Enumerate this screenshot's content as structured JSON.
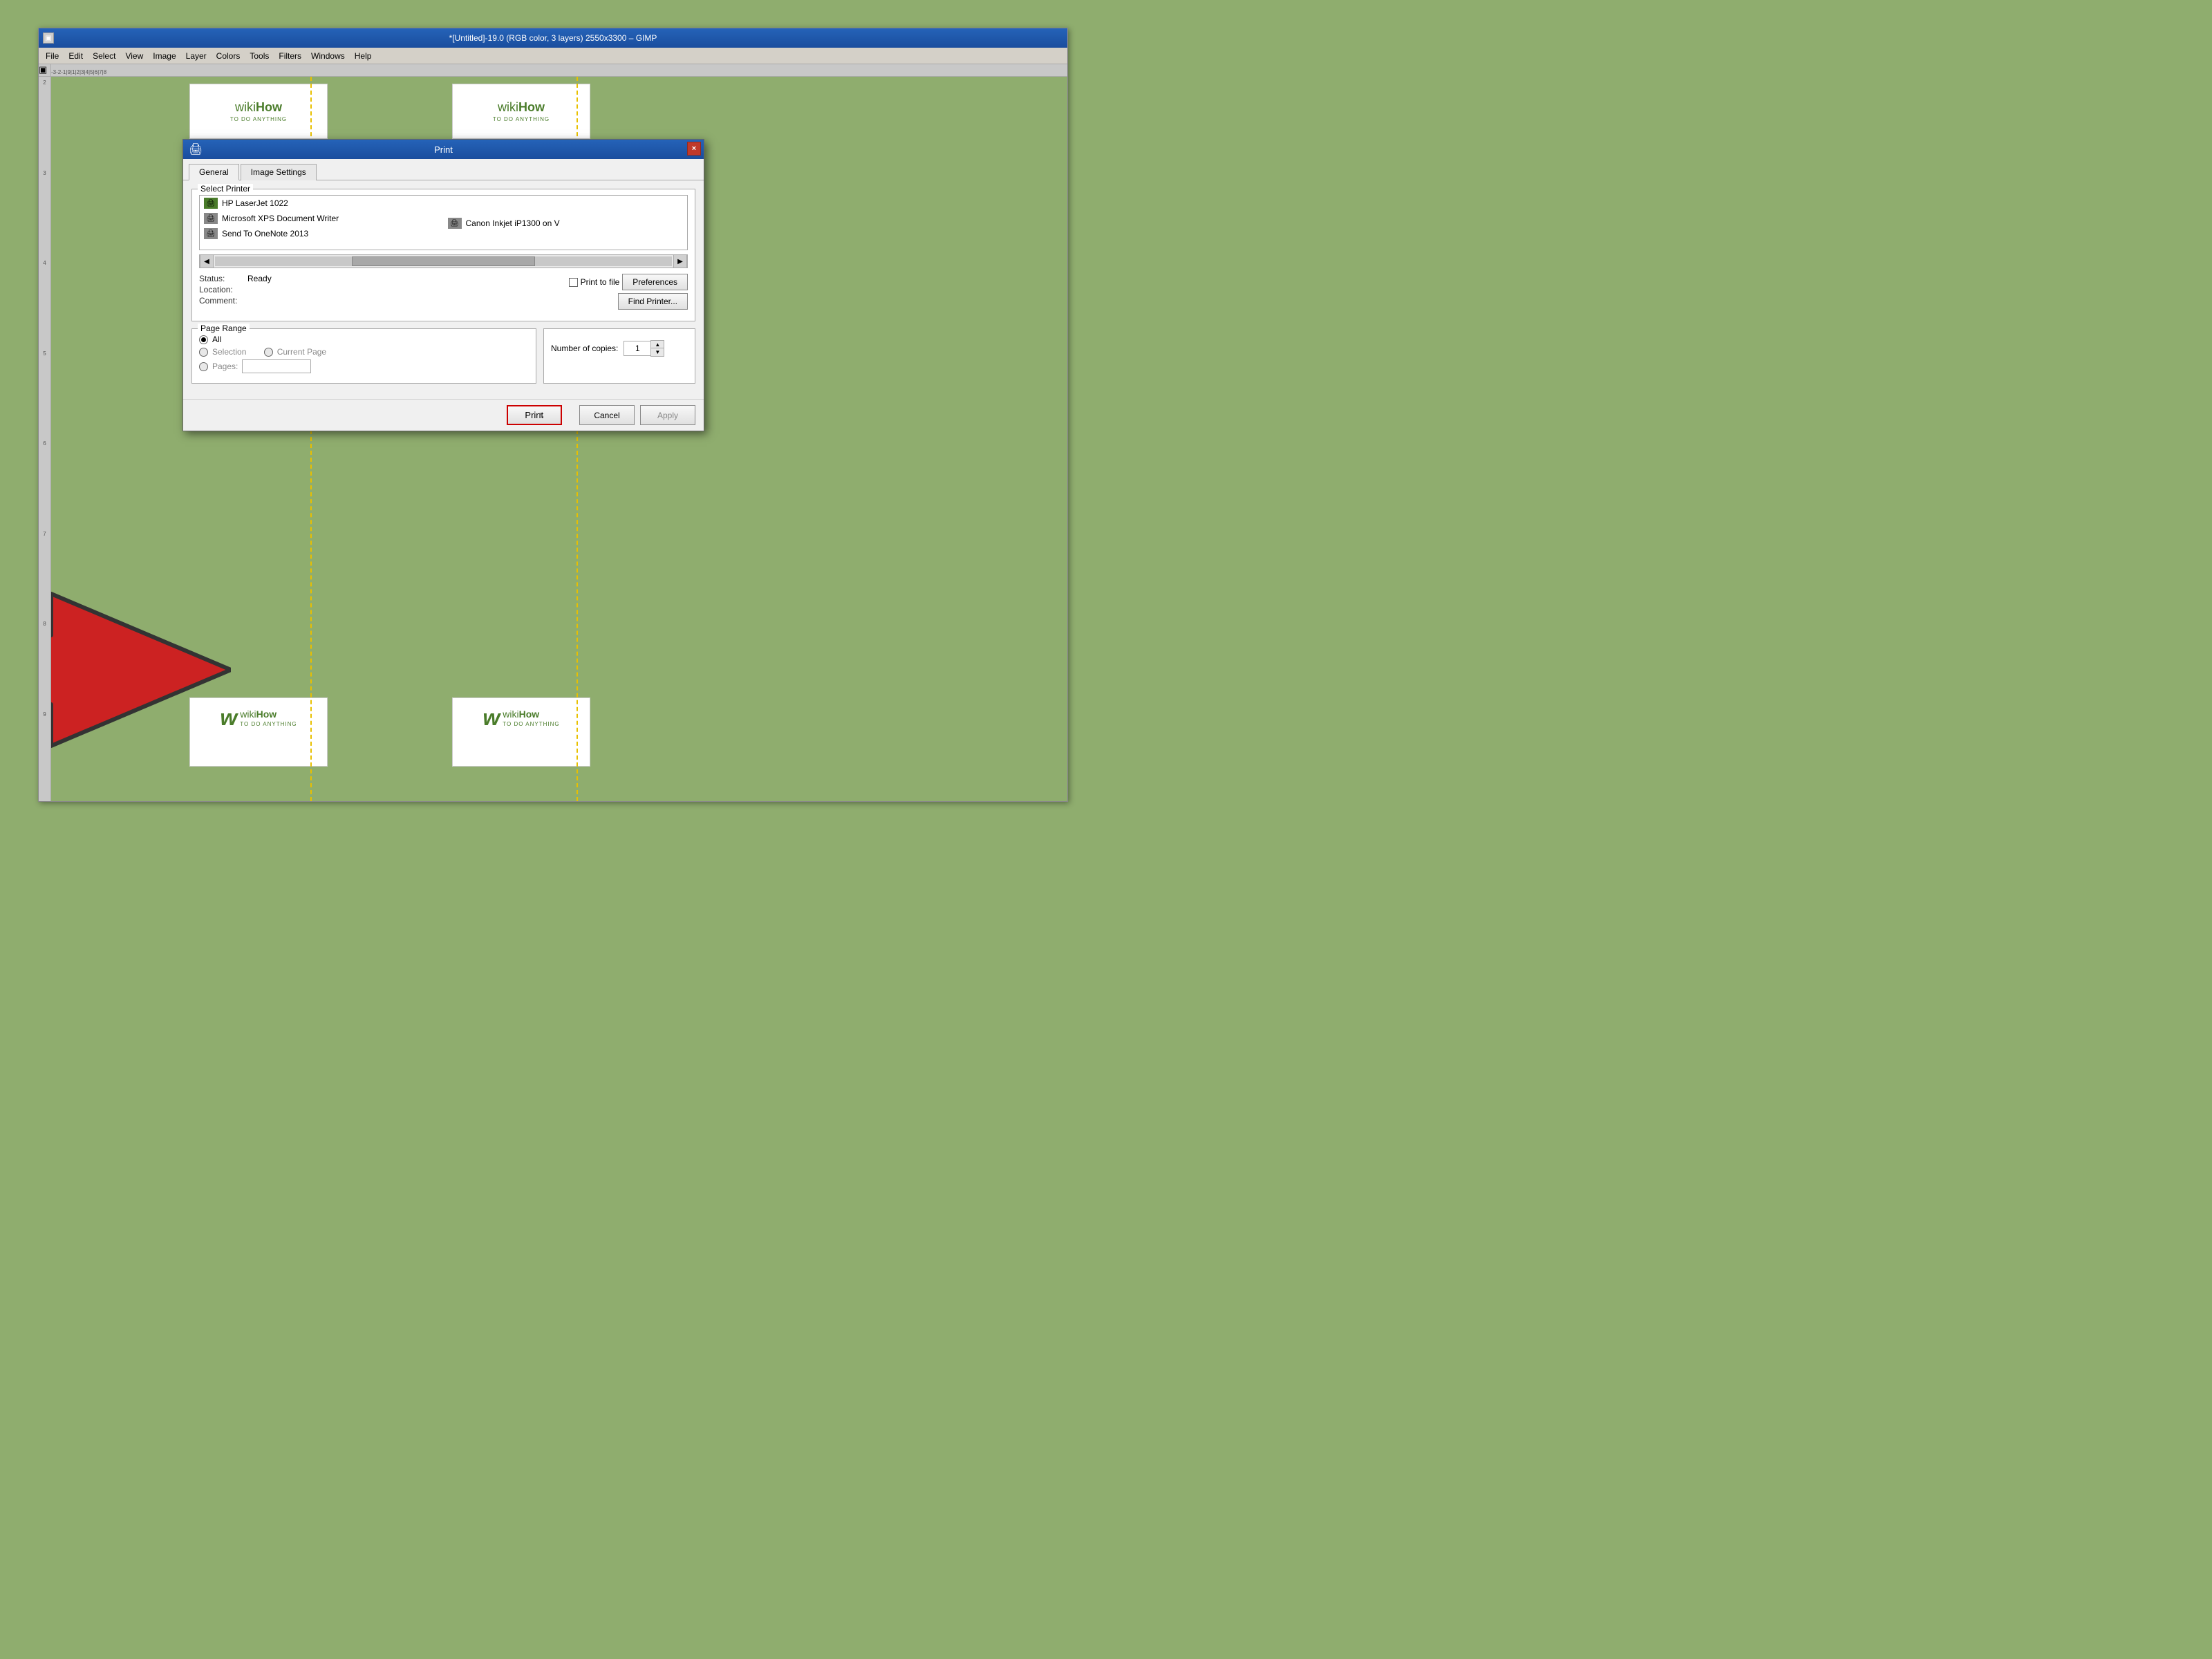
{
  "gimp": {
    "title": "*[Untitled]-19.0 (RGB color, 3 layers) 2550x3300 – GIMP",
    "menu": {
      "items": [
        "File",
        "Edit",
        "Select",
        "View",
        "Image",
        "Layer",
        "Colors",
        "Tools",
        "Filters",
        "Windows",
        "Help"
      ]
    }
  },
  "dialog": {
    "title": "Print",
    "printer_icon": "🖨",
    "close_label": "×",
    "tabs": [
      {
        "label": "General",
        "active": true
      },
      {
        "label": "Image Settings",
        "active": false
      }
    ],
    "select_printer_label": "Select Printer",
    "printers": [
      {
        "name": "HP LaserJet 1022",
        "icon": "🖨",
        "selected": false
      },
      {
        "name": "Canon Inkjet iP1300 on V",
        "icon": "🖨",
        "selected": false
      },
      {
        "name": "Microsoft XPS Document Writer",
        "icon": "🖨",
        "selected": false
      },
      {
        "name": "Send To OneNote 2013",
        "icon": "🖨",
        "selected": false
      }
    ],
    "status_label": "Status:",
    "status_value": "Ready",
    "location_label": "Location:",
    "location_value": "",
    "comment_label": "Comment:",
    "comment_value": "",
    "print_to_file_label": "Print to file",
    "preferences_label": "Preferences",
    "find_printer_label": "Find Printer...",
    "page_range_label": "Page Range",
    "range_options": [
      {
        "label": "All",
        "checked": true,
        "disabled": false
      },
      {
        "label": "Selection",
        "checked": false,
        "disabled": true
      },
      {
        "label": "Current Page",
        "checked": false,
        "disabled": true
      },
      {
        "label": "Pages:",
        "checked": false,
        "disabled": true
      }
    ],
    "copies_label": "Number of copies:",
    "copies_value": "1",
    "print_button": "Print",
    "cancel_button": "Cancel",
    "apply_button": "Apply"
  },
  "wikihow": {
    "logo_wiki": "wiki",
    "logo_how": "How",
    "subtitle": "TO DO ANYTHING"
  },
  "cursor": "↖"
}
